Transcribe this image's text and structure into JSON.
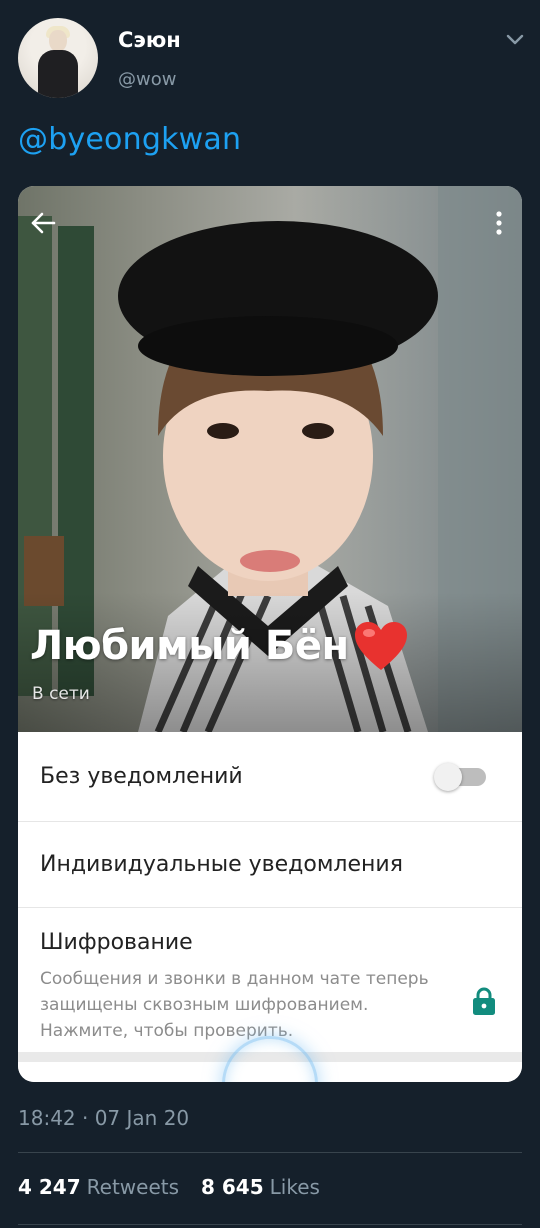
{
  "tweet": {
    "author_name": "Сэюн",
    "author_handle": "@wow",
    "text": "@byeongkwan",
    "timestamp": "18:42 · 07 Jan 20",
    "retweets_count": "4 247",
    "retweets_label": "Retweets",
    "likes_count": "8 645",
    "likes_label": "Likes"
  },
  "chat_info": {
    "contact_name": "Любимый Бён",
    "status": "В сети",
    "settings": [
      {
        "label": "Без уведомлений",
        "toggle_on": false
      },
      {
        "label": "Индивидуальные уведомления"
      },
      {
        "label": "Шифрование",
        "description": "Сообщения и звонки в данном чате теперь защищены сквозным шифрованием. Нажмите, чтобы проверить."
      }
    ]
  },
  "colors": {
    "background": "#15202b",
    "link": "#1da1f2",
    "secondary_text": "#8899a6",
    "lock": "#128c7e"
  },
  "icons": [
    "chevron-down-icon",
    "back-arrow-icon",
    "more-vert-icon",
    "heart-icon",
    "lock-icon"
  ]
}
